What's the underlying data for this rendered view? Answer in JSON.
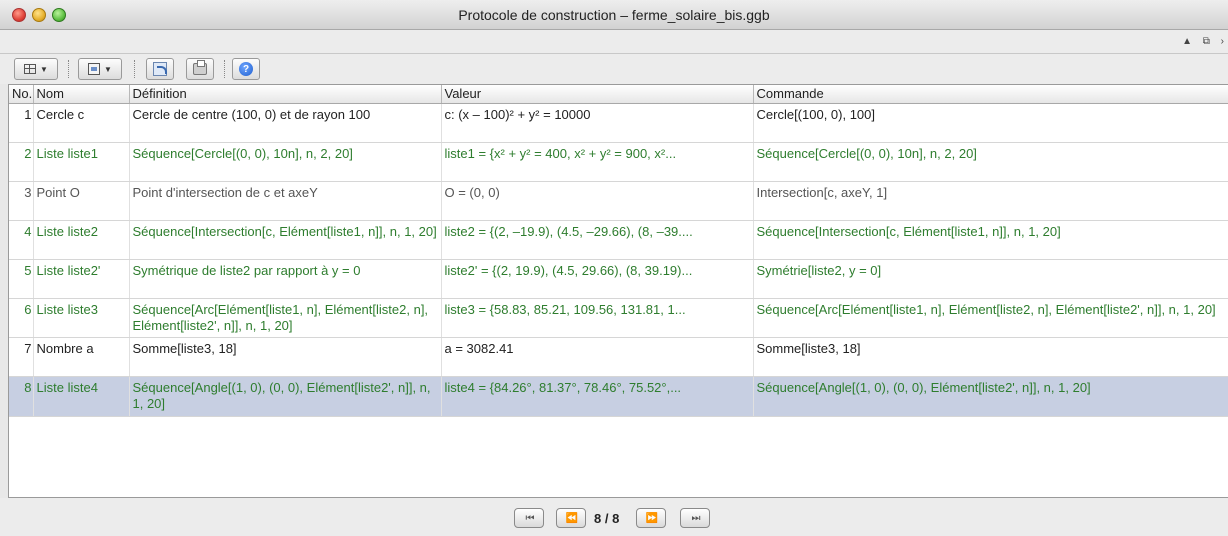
{
  "window": {
    "title": "Protocole de construction – ferme_solaire_bis.ggb"
  },
  "strip": {
    "controls": "▲ ⧉ ›"
  },
  "toolbar": {
    "buttons": [
      {
        "icon": "table-columns-icon"
      },
      {
        "icon": "document-options-icon"
      },
      {
        "icon": "export-html-icon"
      },
      {
        "icon": "print-icon"
      },
      {
        "icon": "help-icon",
        "label": "?"
      }
    ],
    "caret": "▼"
  },
  "table": {
    "headers": [
      "No.",
      "Nom",
      "Définition",
      "Valeur",
      "Commande"
    ],
    "rows": [
      {
        "no": "1",
        "name": "Cercle c",
        "definition": "Cercle de centre (100, 0) et de rayon 100",
        "value": "c: (x – 100)² + y² = 10000",
        "command": "Cercle[(100, 0), 100]",
        "style": "dark"
      },
      {
        "no": "2",
        "name": "Liste liste1",
        "definition": "Séquence[Cercle[(0, 0), 10n], n, 2, 20]",
        "value": "liste1 = {x² + y² = 400, x² + y² = 900, x²...",
        "command": "Séquence[Cercle[(0, 0), 10n], n, 2, 20]",
        "style": "green"
      },
      {
        "no": "3",
        "name": "Point O",
        "definition": "Point d'intersection de c et axeY",
        "value": "O = (0, 0)",
        "command": "Intersection[c, axeY, 1]",
        "style": "grey"
      },
      {
        "no": "4",
        "name": "Liste liste2",
        "definition": "Séquence[Intersection[c, Elément[liste1, n]], n, 1, 20]",
        "value": "liste2 = {(2, –19.9), (4.5, –29.66), (8, –39....",
        "command": "Séquence[Intersection[c, Elément[liste1, n]], n, 1, 20]",
        "style": "green"
      },
      {
        "no": "5",
        "name": "Liste liste2'",
        "definition": "Symétrique de liste2 par rapport à y = 0",
        "value": "liste2' = {(2, 19.9), (4.5, 29.66), (8, 39.19)...",
        "command": "Symétrie[liste2, y = 0]",
        "style": "green"
      },
      {
        "no": "6",
        "name": "Liste liste3",
        "definition": "Séquence[Arc[Elément[liste1, n], Elément[liste2, n], Elément[liste2', n]], n, 1, 20]",
        "value": "liste3 = {58.83, 85.21, 109.56, 131.81, 1...",
        "command": "Séquence[Arc[Elément[liste1, n], Elément[liste2, n], Elément[liste2', n]], n, 1, 20]",
        "style": "green"
      },
      {
        "no": "7",
        "name": "Nombre a",
        "definition": "Somme[liste3, 18]",
        "value": "a = 3082.41",
        "command": "Somme[liste3, 18]",
        "style": "dark"
      },
      {
        "no": "8",
        "name": "Liste liste4",
        "definition": "Séquence[Angle[(1, 0), (0, 0), Elément[liste2', n]], n, 1, 20]",
        "value": "liste4 = {84.26°, 81.37°, 78.46°, 75.52°,...",
        "command": "Séquence[Angle[(1, 0), (0, 0), Elément[liste2', n]], n, 1, 20]",
        "style": "green",
        "selected": true
      }
    ]
  },
  "navigation": {
    "first_label": "⏮",
    "prev_label": "⏪",
    "page": "8 / 8",
    "next_label": "⏩",
    "last_label": "⏭"
  },
  "colors": {
    "selected_row": "#c7cfe2",
    "green_text": "#2e7d2e"
  }
}
